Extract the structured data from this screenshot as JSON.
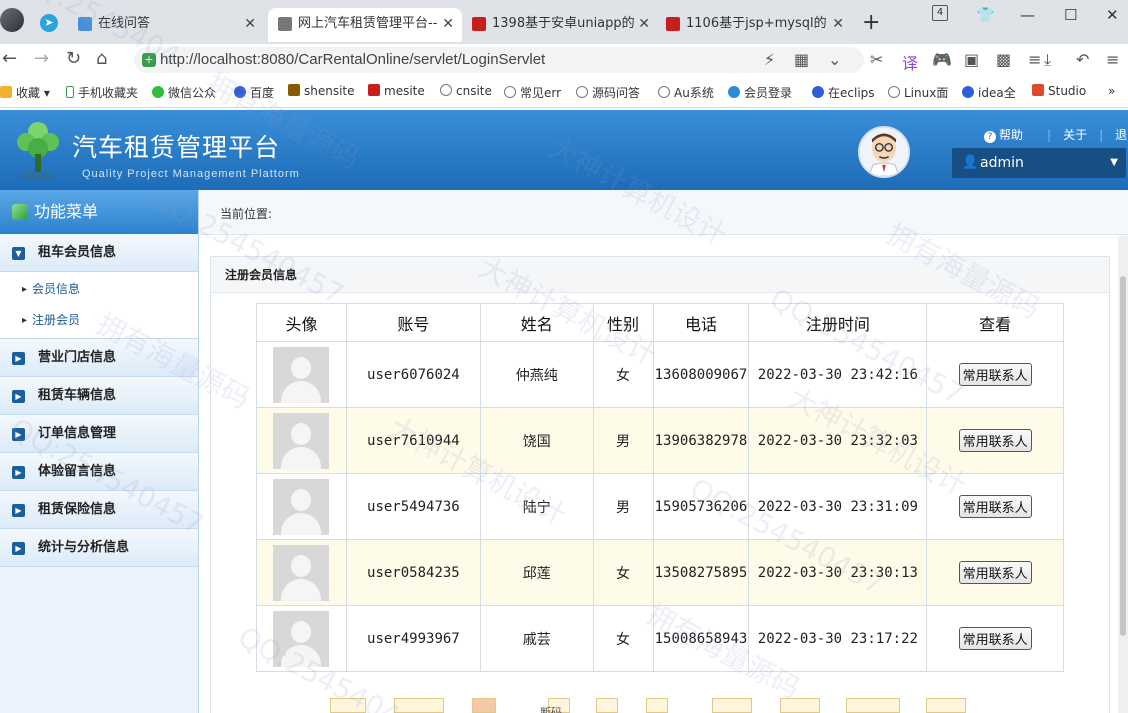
{
  "browser": {
    "tabs": [
      {
        "title": "在线问答",
        "color": "#4a90d9"
      },
      {
        "title": "网上汽车租赁管理平台--",
        "color": "#777777"
      },
      {
        "title": "1398基于安卓uniapp的",
        "color": "#c81e1e"
      },
      {
        "title": "1106基于jsp+mysql的",
        "color": "#c81e1e"
      }
    ],
    "tab_count": "4",
    "url": "http://localhost:8080/CarRentalOnline/servlet/LoginServlet",
    "bookmarks": [
      "收藏",
      "手机收藏夹",
      "微信公众",
      "百度",
      "shensite",
      "mesite",
      "cnsite",
      "常见err",
      "源码问答",
      "Au系统",
      "会员登录",
      "在eclips",
      "Linux面",
      "idea全",
      "Studio"
    ]
  },
  "header": {
    "title": "汽车租赁管理平台",
    "subtitle": "Quality Project Management Plattorm",
    "links": [
      "帮助",
      "关于",
      "退出"
    ],
    "user": "admin"
  },
  "sidebar": {
    "title": "功能菜单",
    "groups": [
      {
        "label": "租车会员信息",
        "items": [
          "会员信息",
          "注册会员"
        ]
      },
      {
        "label": "营业门店信息"
      },
      {
        "label": "租赁车辆信息"
      },
      {
        "label": "订单信息管理"
      },
      {
        "label": "体验留言信息"
      },
      {
        "label": "租赁保险信息"
      },
      {
        "label": "统计与分析信息"
      }
    ]
  },
  "main": {
    "breadcrumb": "当前位置:",
    "panel_title": "注册会员信息",
    "columns": [
      "头像",
      "账号",
      "姓名",
      "性别",
      "电话",
      "注册时间",
      "查看"
    ],
    "rows": [
      {
        "account": "user6076024",
        "name": "仲燕纯",
        "gender": "女",
        "phone": "13608009067",
        "time": "2022-03-30 23:42:16",
        "action": "常用联系人"
      },
      {
        "account": "user7610944",
        "name": "饶国",
        "gender": "男",
        "phone": "13906382978",
        "time": "2022-03-30 23:32:03",
        "action": "常用联系人"
      },
      {
        "account": "user5494736",
        "name": "陆宁",
        "gender": "男",
        "phone": "15905736206",
        "time": "2022-03-30 23:31:09",
        "action": "常用联系人"
      },
      {
        "account": "user0584235",
        "name": "邱莲",
        "gender": "女",
        "phone": "13508275895",
        "time": "2022-03-30 23:30:13",
        "action": "常用联系人"
      },
      {
        "account": "user4993967",
        "name": "戚芸",
        "gender": "女",
        "phone": "15008658943",
        "time": "2022-03-30 23:17:22",
        "action": "常用联系人"
      }
    ],
    "status": "断码"
  },
  "watermarks": [
    "QQ:2545404",
    "大神计算机设计",
    "拥有海量源码",
    "QQ:254540457",
    "大神计算机设计",
    "拥有海量源码",
    "QQ:254540457",
    "大神计算机设计",
    "拥有海量源码",
    "QQ:254540457",
    "QQ:254540457",
    "拥有海量源码",
    "QQ:2545404",
    "大神计算机设计"
  ]
}
